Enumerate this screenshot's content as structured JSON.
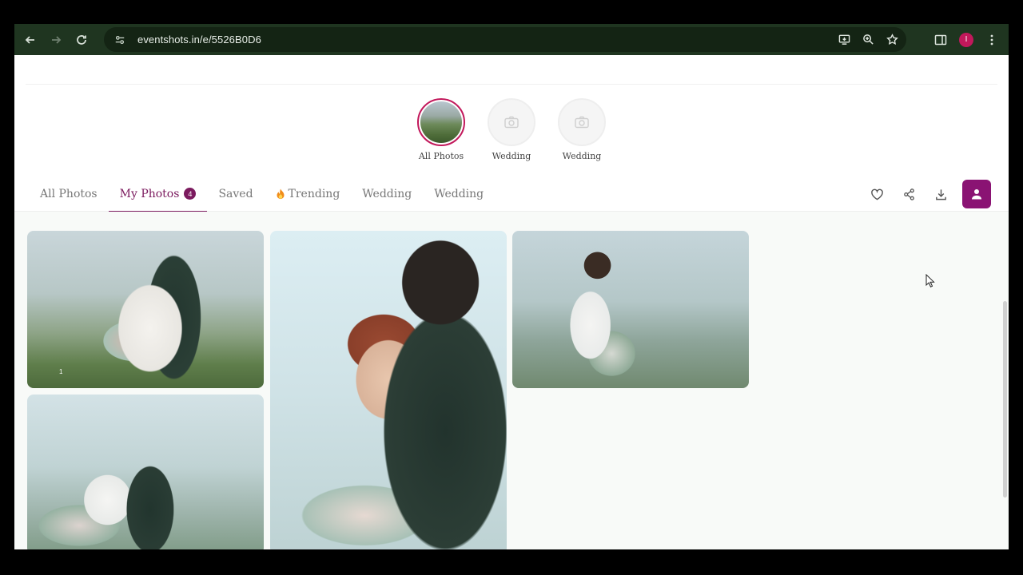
{
  "browser": {
    "url": "eventshots.in/e/5526B0D6",
    "profile_initial": "I"
  },
  "albums": [
    {
      "label": "All Photos",
      "has_thumbnail": true,
      "active": true
    },
    {
      "label": "Wedding",
      "has_thumbnail": false,
      "active": false
    },
    {
      "label": "Wedding",
      "has_thumbnail": false,
      "active": false
    }
  ],
  "tabs": {
    "all_photos": "All Photos",
    "my_photos": "My Photos",
    "my_photos_count": "4",
    "saved": "Saved",
    "trending": "Trending",
    "wedding_1": "Wedding",
    "wedding_2": "Wedding"
  },
  "gallery": {
    "photo_1_number": "1"
  },
  "colors": {
    "accent": "#7b1a5e",
    "button": "#8a1373",
    "chrome": "#1f3520"
  }
}
